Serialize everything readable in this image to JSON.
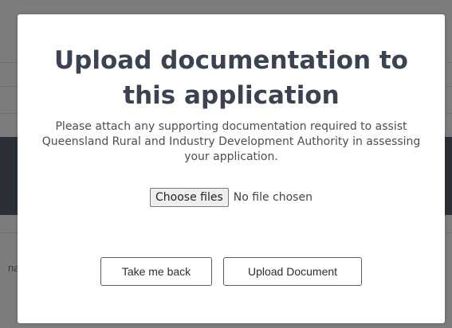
{
  "background": {
    "partial_text": "na"
  },
  "modal": {
    "title": "Upload documentation to this application",
    "description": "Please attach any supporting documentation required to assist Queensland Rural and Industry Development Authority in assessing your application.",
    "file_input": {
      "button_label": "Choose files",
      "status_text": "No file chosen"
    },
    "buttons": {
      "back_label": "Take me back",
      "upload_label": "Upload Document"
    }
  }
}
